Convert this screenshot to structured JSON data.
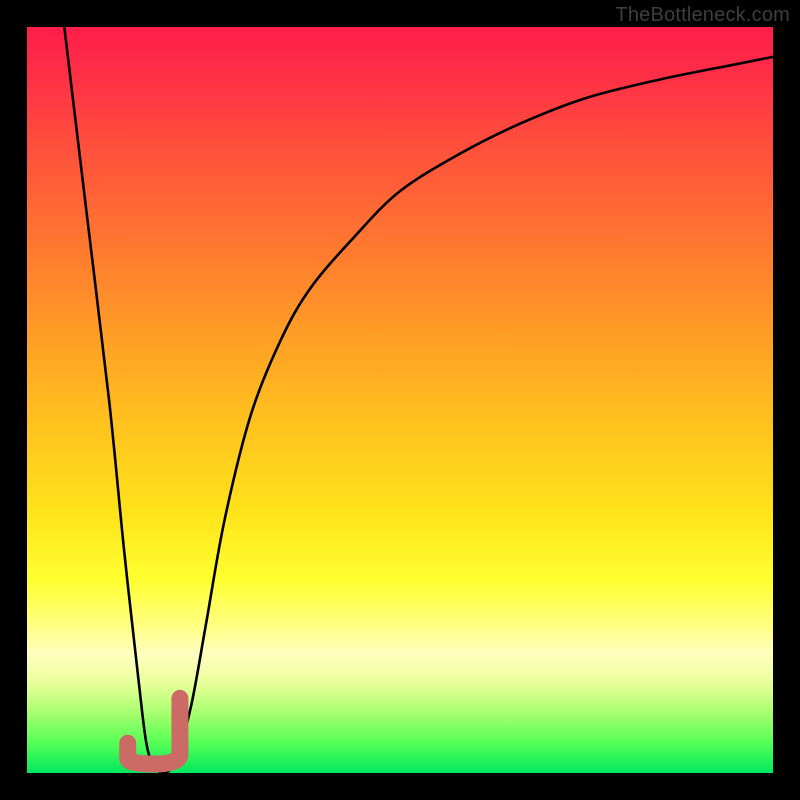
{
  "watermark": {
    "text": "TheBottleneck.com"
  },
  "colors": {
    "background": "#000000",
    "curve_stroke": "#000000",
    "marker_stroke": "#cc6a66",
    "gradient_top": "#ff1e4a",
    "gradient_bottom": "#00e85e"
  },
  "chart_data": {
    "type": "line",
    "title": "",
    "xlabel": "",
    "ylabel": "",
    "xlim": [
      0,
      100
    ],
    "ylim": [
      0,
      100
    ],
    "annotations": [],
    "series": [
      {
        "name": "bottleneck-curve",
        "x": [
          5,
          8,
          11,
          13,
          15,
          16,
          17,
          18.5,
          20,
          22,
          24,
          26.5,
          30,
          34,
          38,
          44,
          50,
          58,
          66,
          75,
          85,
          95,
          100
        ],
        "y": [
          100,
          75,
          50,
          30,
          12,
          4,
          1,
          0,
          2,
          9,
          20,
          34,
          48,
          58,
          65,
          72,
          78,
          83,
          87,
          90.5,
          93,
          95,
          96
        ]
      }
    ],
    "marker": {
      "description": "J-shaped highlight at curve minimum",
      "x_range": [
        13.5,
        20.5
      ],
      "y_range": [
        0,
        10
      ]
    }
  }
}
